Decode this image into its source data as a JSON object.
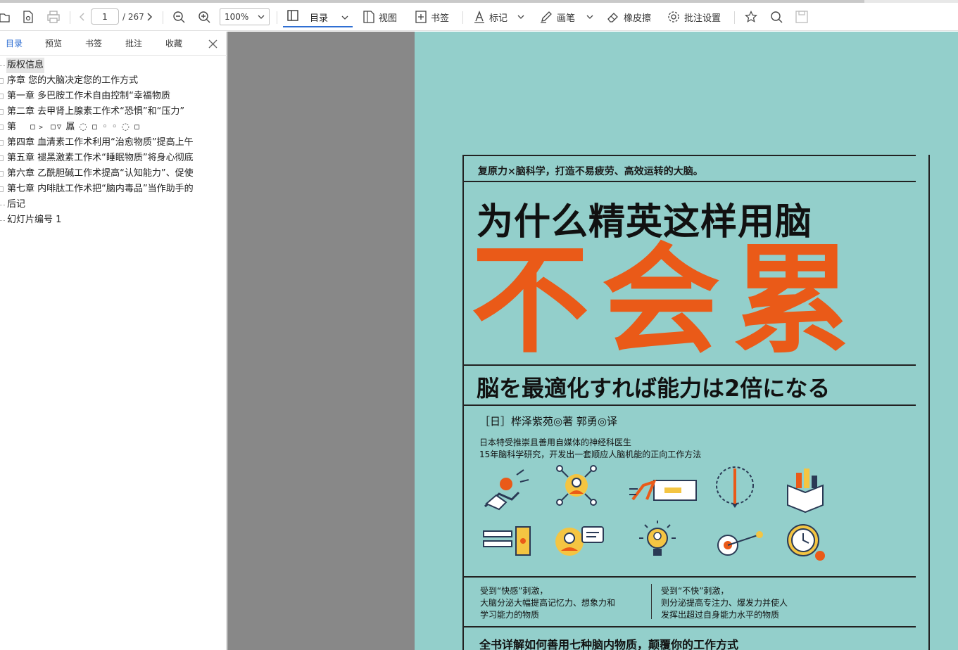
{
  "toolbar": {
    "page_current": "1",
    "page_total": "/ 267",
    "zoom": "100%",
    "mulu_label": "目录",
    "view_label": "视图",
    "bookmark_label": "书签",
    "mark_label": "标记",
    "pen_label": "画笔",
    "eraser_label": "橡皮擦",
    "annot_settings_label": "批注设置"
  },
  "sidebar": {
    "tabs": [
      "目录",
      "预览",
      "书签",
      "批注",
      "收藏"
    ],
    "active_tab": 0,
    "toc": [
      {
        "label": "版权信息",
        "expandable": false,
        "selected": true
      },
      {
        "label": "序章 您的大脑决定您的工作方式",
        "expandable": true
      },
      {
        "label": "第一章 多巴胺工作术自由控制“幸福物质",
        "expandable": true
      },
      {
        "label": "第二章 去甲肾上腺素工作术“恐惧”和“压力”",
        "expandable": true
      },
      {
        "label": "第",
        "expandable": true,
        "garbled": true
      },
      {
        "label": "第四章 血清素工作术利用“治愈物质”提高上午",
        "expandable": true
      },
      {
        "label": "第五章 褪黑激素工作术“睡眠物质”将身心彻底",
        "expandable": true
      },
      {
        "label": "第六章 乙酰胆碱工作术提高“认知能力”、促使",
        "expandable": true
      },
      {
        "label": "第七章 内啡肽工作术把“脑内毒品”当作助手的",
        "expandable": true
      },
      {
        "label": "后记",
        "expandable": false
      },
      {
        "label": "幻灯片编号 1",
        "expandable": false
      }
    ]
  },
  "cover": {
    "subtitle": "复原力×脑科学，打造不易疲劳、高效运转的大脑。",
    "title_line1": "为什么精英这样用脑",
    "title_line2": "不会累",
    "jp_subtitle": "脳を最適化すれば能力は2倍になる",
    "author": "［日］桦泽紫苑◎著  郭勇◎译",
    "blurb1": "日本特受推崇且善用自媒体的神经科医生",
    "blurb2": "15年脑科学研究，开发出一套顺应人脑机能的正向工作方法",
    "col1": [
      "受到“快感”刺激，",
      "大脑分泌大幅提高记忆力、想象力和",
      "学习能力的物质"
    ],
    "col2": [
      "受到“不快”刺激，",
      "则分泌提高专注力、爆发力并使人",
      "发挥出超过自身能力水平的物质"
    ],
    "bottom": "全书详解如何善用七种脑内物质，颠覆你的工作方式",
    "accent_color": "#ea5a18",
    "background_color": "#93cfcb"
  }
}
